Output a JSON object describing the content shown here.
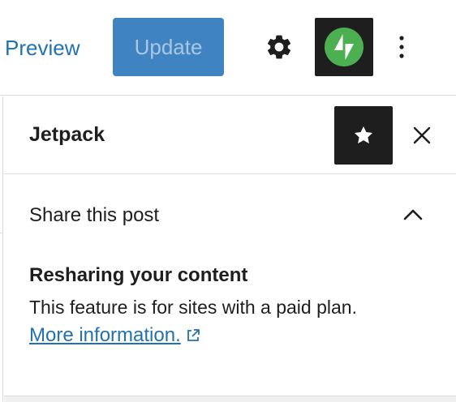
{
  "toolbar": {
    "preview_label": "Preview",
    "update_label": "Update",
    "icons": {
      "settings": "gear-icon",
      "jetpack": "jetpack-bolt-icon",
      "more": "vertical-ellipsis-icon"
    },
    "colors": {
      "link": "#2271b1",
      "update_bg": "#3f83c1",
      "jetpack_green": "#4caf50",
      "dark_button": "#1e1e1e"
    }
  },
  "sidebar": {
    "title": "Jetpack",
    "icons": {
      "star": "star-icon",
      "close": "close-icon"
    },
    "panel": {
      "title": "Share this post",
      "expanded": true,
      "resharing_title": "Resharing your content",
      "resharing_description": "This feature is for sites with a paid plan.",
      "more_info_label": "More information.",
      "icons": {
        "chevron": "chevron-up-icon",
        "external": "external-link-icon"
      }
    }
  }
}
